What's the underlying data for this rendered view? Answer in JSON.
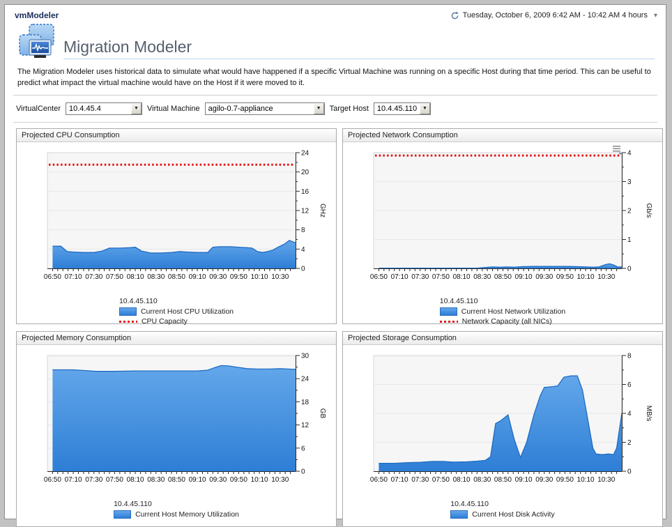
{
  "window": {
    "app_title": "vmModeler",
    "time_range": "Tuesday, October 6, 2009 6:42 AM - 10:42 AM 4 hours"
  },
  "page": {
    "title": "Migration Modeler",
    "description": "The Migration Modeler uses historical data to simulate what would have happened if a specific Virtual Machine was running on a specific Host during that time period. This can be useful to predict what impact the virtual machine would have on the Host if it were moved to it."
  },
  "controls": {
    "virtualcenter_label": "VirtualCenter",
    "virtualcenter_value": "10.4.45.4",
    "vm_label": "Virtual Machine",
    "vm_value": "agilo-0.7-appliance",
    "target_host_label": "Target Host",
    "target_host_value": "10.4.45.110"
  },
  "colors": {
    "area_fill_top": "#63a7ea",
    "area_fill_bottom": "#2e7ed6",
    "area_stroke": "#1f6cc2",
    "capacity_red": "#e61010",
    "plot_bg": "#f6f6f6",
    "grid": "#e7e7e7",
    "axis": "#2a2a2a",
    "title_underline": "#bcd2e8"
  },
  "chart_data": {
    "x_axis": {
      "xlim_minutes": [
        -5,
        235
      ],
      "minor_step": 5,
      "label_minutes": [
        0,
        20,
        40,
        60,
        80,
        100,
        120,
        140,
        160,
        180,
        200,
        220
      ],
      "labels": [
        "06:50",
        "07:10",
        "07:30",
        "07:50",
        "08:10",
        "08:30",
        "08:50",
        "09:10",
        "09:30",
        "09:50",
        "10:10",
        "10:30"
      ]
    },
    "charts": [
      {
        "type": "area",
        "title": "Projected CPU Consumption",
        "host": "10.4.45.110",
        "unit": "GHz",
        "ylim": [
          0,
          24
        ],
        "ymajor": 4,
        "yminor": 2,
        "series": [
          {
            "name": "Current Host CPU Utilization",
            "points": [
              [
                0,
                4.6
              ],
              [
                8,
                4.6
              ],
              [
                14,
                3.5
              ],
              [
                20,
                3.4
              ],
              [
                30,
                3.3
              ],
              [
                40,
                3.3
              ],
              [
                48,
                3.6
              ],
              [
                55,
                4.2
              ],
              [
                65,
                4.2
              ],
              [
                75,
                4.3
              ],
              [
                80,
                4.4
              ],
              [
                86,
                3.6
              ],
              [
                95,
                3.2
              ],
              [
                105,
                3.2
              ],
              [
                115,
                3.3
              ],
              [
                123,
                3.5
              ],
              [
                130,
                3.4
              ],
              [
                140,
                3.3
              ],
              [
                150,
                3.3
              ],
              [
                155,
                4.4
              ],
              [
                162,
                4.5
              ],
              [
                172,
                4.5
              ],
              [
                180,
                4.4
              ],
              [
                188,
                4.3
              ],
              [
                193,
                4.2
              ],
              [
                198,
                3.5
              ],
              [
                203,
                3.3
              ],
              [
                208,
                3.5
              ],
              [
                213,
                3.8
              ],
              [
                218,
                4.4
              ],
              [
                224,
                5.0
              ],
              [
                229,
                5.8
              ],
              [
                235,
                5.3
              ]
            ]
          }
        ],
        "capacity": {
          "name": "CPU Capacity",
          "value": 21.5
        },
        "has_options_icon": false
      },
      {
        "type": "area",
        "title": "Projected Network Consumption",
        "host": "10.4.45.110",
        "unit": "Gb/s",
        "ylim": [
          0,
          4
        ],
        "ymajor": 1,
        "yminor": 0.5,
        "series": [
          {
            "name": "Current Host Network Utilization",
            "points": [
              [
                0,
                0.01
              ],
              [
                95,
                0.01
              ],
              [
                102,
                0.03
              ],
              [
                110,
                0.05
              ],
              [
                117,
                0.04
              ],
              [
                124,
                0.05
              ],
              [
                131,
                0.04
              ],
              [
                138,
                0.06
              ],
              [
                148,
                0.07
              ],
              [
                160,
                0.07
              ],
              [
                172,
                0.07
              ],
              [
                184,
                0.07
              ],
              [
                193,
                0.06
              ],
              [
                200,
                0.05
              ],
              [
                207,
                0.04
              ],
              [
                213,
                0.05
              ],
              [
                219,
                0.13
              ],
              [
                223,
                0.16
              ],
              [
                227,
                0.12
              ],
              [
                231,
                0.05
              ],
              [
                235,
                0.05
              ]
            ]
          }
        ],
        "capacity": {
          "name": "Network Capacity (all NICs)",
          "value": 3.9
        },
        "has_options_icon": true
      },
      {
        "type": "area",
        "title": "Projected Memory Consumption",
        "host": "10.4.45.110",
        "unit": "GB",
        "ylim": [
          0,
          30
        ],
        "ymajor": 6,
        "yminor": 3,
        "series": [
          {
            "name": "Current Host Memory Utilization",
            "points": [
              [
                0,
                26.3
              ],
              [
                20,
                26.3
              ],
              [
                32,
                26.1
              ],
              [
                42,
                25.9
              ],
              [
                60,
                25.9
              ],
              [
                80,
                26.0
              ],
              [
                110,
                26.0
              ],
              [
                140,
                26.0
              ],
              [
                150,
                26.2
              ],
              [
                157,
                26.9
              ],
              [
                163,
                27.4
              ],
              [
                170,
                27.3
              ],
              [
                178,
                27.0
              ],
              [
                188,
                26.6
              ],
              [
                198,
                26.5
              ],
              [
                210,
                26.5
              ],
              [
                220,
                26.6
              ],
              [
                228,
                26.5
              ],
              [
                235,
                26.4
              ]
            ]
          }
        ],
        "capacity": null,
        "has_options_icon": false
      },
      {
        "type": "area",
        "title": "Projected Storage Consumption",
        "host": "10.4.45.110",
        "unit": "MB/s",
        "ylim": [
          0,
          8
        ],
        "ymajor": 2,
        "yminor": 1,
        "series": [
          {
            "name": "Current Host Disk Activity",
            "points": [
              [
                0,
                0.55
              ],
              [
                15,
                0.55
              ],
              [
                28,
                0.6
              ],
              [
                40,
                0.62
              ],
              [
                52,
                0.68
              ],
              [
                62,
                0.68
              ],
              [
                72,
                0.63
              ],
              [
                85,
                0.65
              ],
              [
                95,
                0.7
              ],
              [
                103,
                0.75
              ],
              [
                108,
                1.0
              ],
              [
                113,
                3.3
              ],
              [
                118,
                3.5
              ],
              [
                125,
                3.9
              ],
              [
                131,
                2.2
              ],
              [
                137,
                0.95
              ],
              [
                143,
                2.0
              ],
              [
                150,
                3.9
              ],
              [
                156,
                5.2
              ],
              [
                160,
                5.8
              ],
              [
                168,
                5.85
              ],
              [
                173,
                5.9
              ],
              [
                179,
                6.5
              ],
              [
                186,
                6.6
              ],
              [
                192,
                6.6
              ],
              [
                197,
                5.6
              ],
              [
                202,
                3.6
              ],
              [
                207,
                1.6
              ],
              [
                210,
                1.2
              ],
              [
                216,
                1.15
              ],
              [
                222,
                1.2
              ],
              [
                227,
                1.15
              ],
              [
                230,
                1.6
              ],
              [
                235,
                4.0
              ]
            ]
          }
        ],
        "capacity": null,
        "has_options_icon": false
      }
    ]
  }
}
